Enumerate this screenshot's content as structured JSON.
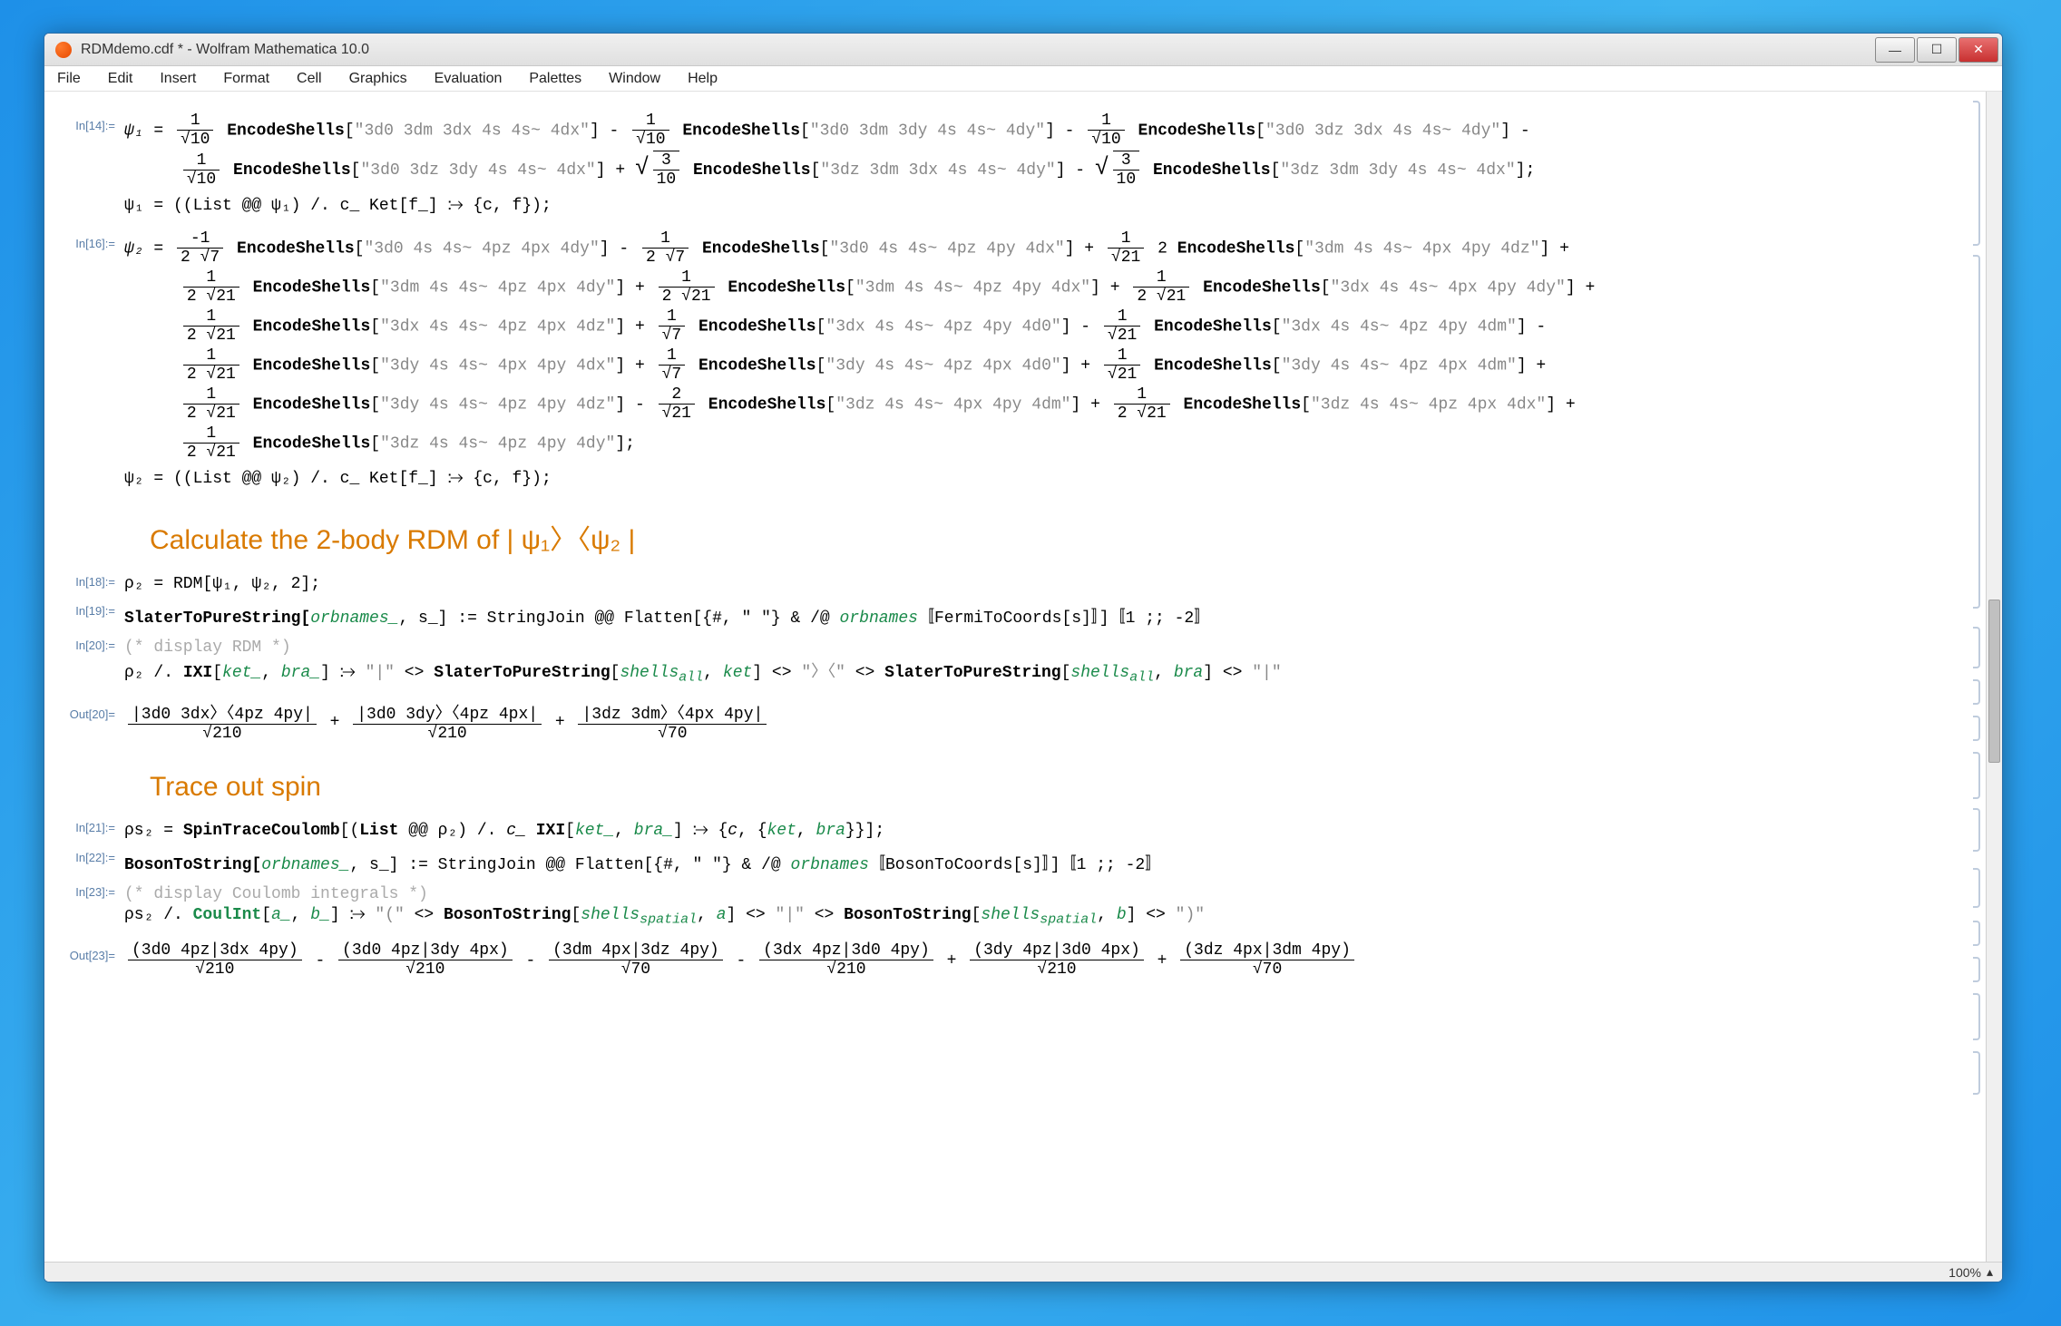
{
  "window": {
    "title": "RDMdemo.cdf * - Wolfram Mathematica 10.0"
  },
  "menus": [
    "File",
    "Edit",
    "Insert",
    "Format",
    "Cell",
    "Graphics",
    "Evaluation",
    "Palettes",
    "Window",
    "Help"
  ],
  "labels": {
    "in14": "In[14]:=",
    "in16": "In[16]:=",
    "in18": "In[18]:=",
    "in19": "In[19]:=",
    "in20": "In[20]:=",
    "out20": "Out[20]=",
    "in21": "In[21]:=",
    "in22": "In[22]:=",
    "in23": "In[23]:=",
    "out23": "Out[23]="
  },
  "psi1": {
    "t1": {
      "num": "1",
      "den": "√10",
      "arg": "3d0 3dm 3dx 4s 4s~ 4dx"
    },
    "t2": {
      "num": "1",
      "den": "√10",
      "arg": "3d0 3dm 3dy 4s 4s~ 4dy"
    },
    "t3": {
      "num": "1",
      "den": "√10",
      "arg": "3d0 3dz 3dx 4s 4s~ 4dy"
    },
    "t4": {
      "num": "1",
      "den": "√10",
      "arg": "3d0 3dz 3dy 4s 4s~ 4dx"
    },
    "t5": {
      "num": "3",
      "den": "10",
      "arg": "3dz 3dm 3dx 4s 4s~ 4dy"
    },
    "t6": {
      "num": "3",
      "den": "10",
      "arg": "3dz 3dm 3dy 4s 4s~ 4dx"
    },
    "rule": "ψ₁ = ((List @@ ψ₁) /. c_ Ket[f_] ⧴ {c, f});"
  },
  "psi2": {
    "r1": [
      {
        "c": "-1",
        "d": "2 √7",
        "arg": "3d0 4s 4s~ 4pz 4px 4dy"
      },
      {
        "c": "1",
        "d": "2 √7",
        "arg": "3d0 4s 4s~ 4pz 4py 4dx"
      },
      {
        "c": "1",
        "d": "√21",
        "pre": "2",
        "arg": "3dm 4s 4s~ 4px 4py 4dz"
      }
    ],
    "r2": [
      {
        "c": "1",
        "d": "2 √21",
        "arg": "3dm 4s 4s~ 4pz 4px 4dy"
      },
      {
        "c": "1",
        "d": "2 √21",
        "arg": "3dm 4s 4s~ 4pz 4py 4dx"
      },
      {
        "c": "1",
        "d": "2 √21",
        "arg": "3dx 4s 4s~ 4px 4py 4dy"
      }
    ],
    "r3": [
      {
        "c": "1",
        "d": "2 √21",
        "arg": "3dx 4s 4s~ 4pz 4px 4dz"
      },
      {
        "c": "1",
        "d": "√7",
        "arg": "3dx 4s 4s~ 4pz 4py 4d0"
      },
      {
        "c": "1",
        "d": "√21",
        "arg": "3dx 4s 4s~ 4pz 4py 4dm"
      }
    ],
    "r4": [
      {
        "c": "1",
        "d": "2 √21",
        "arg": "3dy 4s 4s~ 4px 4py 4dx"
      },
      {
        "c": "1",
        "d": "√7",
        "arg": "3dy 4s 4s~ 4pz 4px 4d0"
      },
      {
        "c": "1",
        "d": "√21",
        "arg": "3dy 4s 4s~ 4pz 4px 4dm"
      }
    ],
    "r5": [
      {
        "c": "1",
        "d": "2 √21",
        "arg": "3dy 4s 4s~ 4pz 4py 4dz"
      },
      {
        "c": "2",
        "d": "√21",
        "arg": "3dz 4s 4s~ 4px 4py 4dm"
      },
      {
        "c": "1",
        "d": "2 √21",
        "arg": "3dz 4s 4s~ 4pz 4px 4dx"
      }
    ],
    "r6": [
      {
        "c": "1",
        "d": "2 √21",
        "arg": "3dz 4s 4s~ 4pz 4py 4dy"
      }
    ],
    "rule": "ψ₂ = ((List @@ ψ₂) /. c_ Ket[f_] ⧴ {c, f});"
  },
  "section1": "Calculate the 2-body RDM of  | ψ₁〉〈ψ₂ |",
  "in18_code": "ρ₂ = RDM[ψ₁, ψ₂, 2];",
  "in19_code": {
    "pre": "SlaterToPureString[",
    "arg1": "orbnames_",
    "mid": ", s_] := StringJoin @@ Flatten[{#, \" \"} & /@ ",
    "arg2": "orbnames",
    "tail": "〚FermiToCoords[s]〛]〚1 ;; -2〛"
  },
  "in20_comment": "(* display RDM *)",
  "in20_code": "ρ₂ /. IXI[ket_, bra_] ⧴ \"|\" <> SlaterToPureString[shellsₐₗₗ, ket] <> \"〉〈\" <> SlaterToPureString[shellsₐₗₗ, bra] <> \"|\"",
  "out20_terms": [
    {
      "num": "|3d0 3dx〉〈4pz 4py|",
      "den": "√210"
    },
    {
      "num": "|3d0 3dy〉〈4pz 4px|",
      "den": "√210"
    },
    {
      "num": "|3dz 3dm〉〈4px 4py|",
      "den": "√70"
    }
  ],
  "section2": "Trace out spin",
  "in21_code": "ρs₂ = SpinTraceCoulomb[(List @@ ρ₂) /. c_ IXI[ket_, bra_] ⧴ {c, {ket, bra}}];",
  "in22_code": {
    "pre": "BosonToString[",
    "arg1": "orbnames_",
    "mid": ", s_] := StringJoin @@ Flatten[{#, \" \"} & /@ ",
    "arg2": "orbnames",
    "tail": "〚BosonToCoords[s]〛]〚1 ;; -2〛"
  },
  "in23_comment": "(* display Coulomb integrals *)",
  "in23_code": "ρs₂ /. CoulInt[a_, b_] ⧴ \"(\" <> BosonToString[shellsspatial, a] <> \"|\" <> BosonToString[shellsspatial, b] <> \")\"",
  "out23_terms": [
    {
      "num": "(3d0 4pz|3dx 4py)",
      "den": "√210"
    },
    {
      "num": "(3d0 4pz|3dy 4px)",
      "den": "√210"
    },
    {
      "num": "(3dm 4px|3dz 4py)",
      "den": "√70"
    },
    {
      "num": "(3dx 4pz|3d0 4py)",
      "den": "√210"
    },
    {
      "num": "(3dy 4pz|3d0 4px)",
      "den": "√210"
    },
    {
      "num": "(3dz 4px|3dm 4py)",
      "den": "√70"
    }
  ],
  "status": {
    "zoom": "100%"
  }
}
